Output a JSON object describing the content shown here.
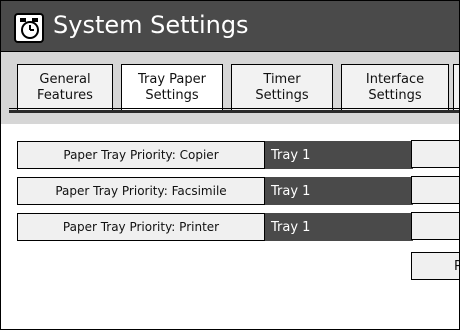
{
  "header": {
    "title": "System Settings",
    "icon": "settings-clock-icon"
  },
  "tabs": [
    {
      "label": "General\nFeatures",
      "active": false
    },
    {
      "label": "Tray Paper\nSettings",
      "active": true
    },
    {
      "label": "Timer\nSettings",
      "active": false
    },
    {
      "label": "Interface\nSettings",
      "active": false
    }
  ],
  "rows": [
    {
      "label": "Paper Tray Priority: Copier",
      "value": "Tray 1"
    },
    {
      "label": "Paper Tray Priority: Facsimile",
      "value": "Tray 1"
    },
    {
      "label": "Paper Tray Priority: Printer",
      "value": "Tray 1"
    }
  ],
  "side_buttons": {
    "partial_label": "P"
  },
  "colors": {
    "header_bg": "#4a4a4a",
    "value_bg": "#4a4a4a",
    "tabstrip_bg": "#d6d6d6"
  }
}
